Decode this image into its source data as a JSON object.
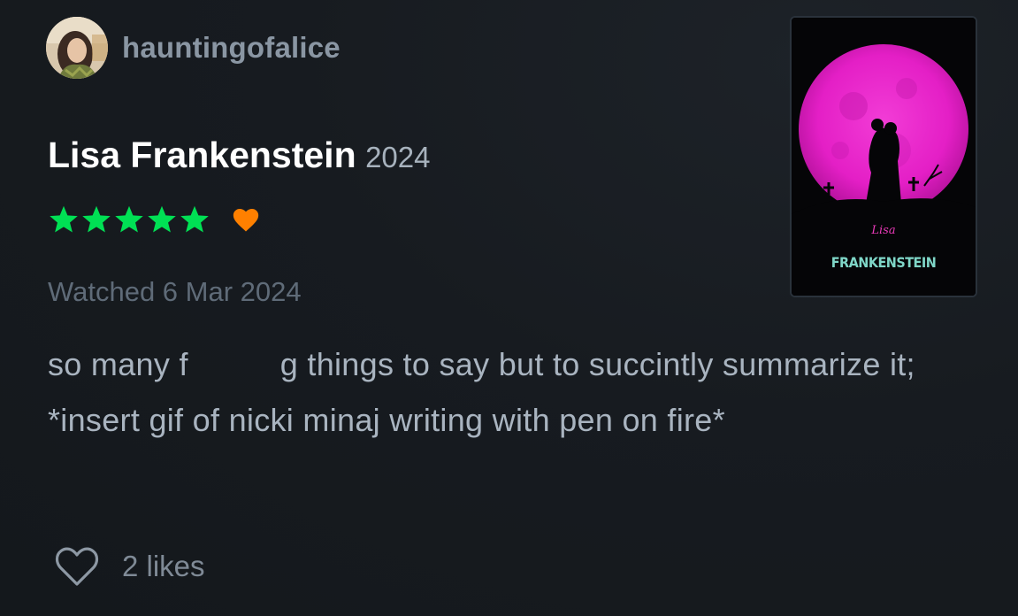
{
  "review": {
    "author": {
      "username": "hauntingofalice",
      "avatar": "avatar-photo"
    },
    "film": {
      "title": "Lisa Frankenstein",
      "year": "2024",
      "poster_text": "FRANKENSTEIN",
      "poster_script": "Lisa"
    },
    "rating": {
      "stars": 5,
      "max_stars": 5,
      "liked": true,
      "star_color": "#00e054",
      "heart_color": "#ff8000"
    },
    "watched_label": "Watched 6 Mar 2024",
    "body": {
      "part1": "so many f",
      "part2": "g things to say but to succintly summarize it; *insert gif of nicki minaj writing with pen on fire*"
    },
    "likes": {
      "count_label": "2 likes",
      "icon": "heart-outline-icon"
    }
  }
}
